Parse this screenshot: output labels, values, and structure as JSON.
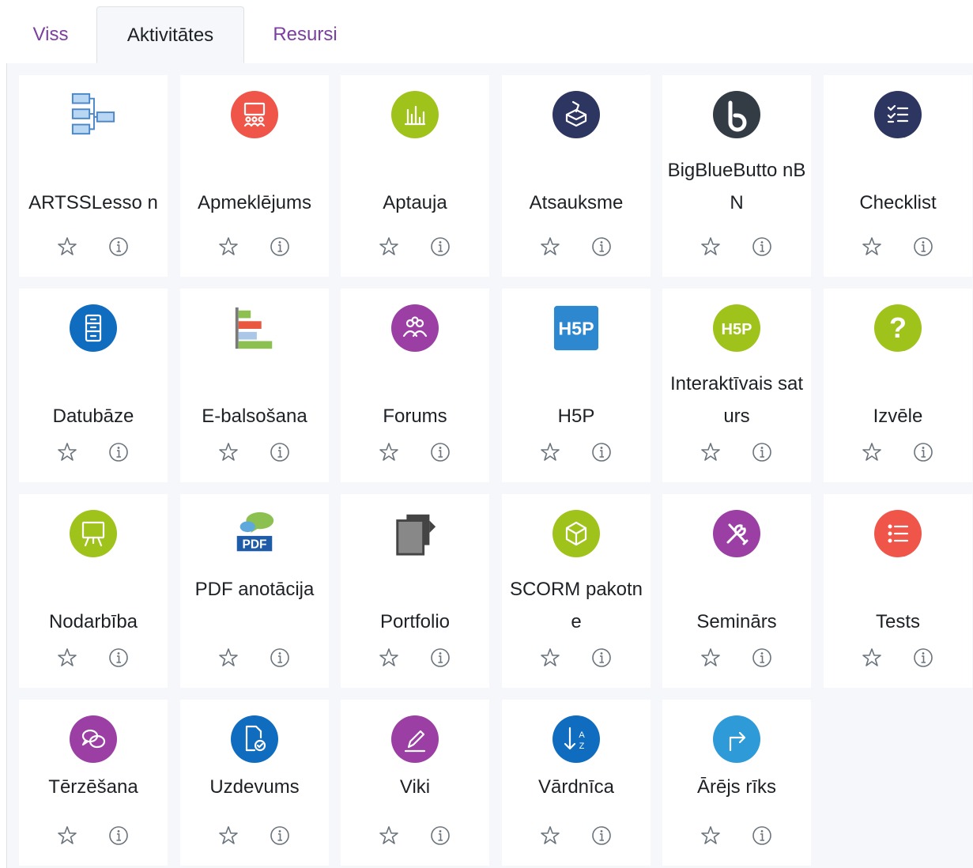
{
  "tabs": [
    {
      "label": "Viss",
      "active": false
    },
    {
      "label": "Aktivitātes",
      "active": true
    },
    {
      "label": "Resursi",
      "active": false
    }
  ],
  "modules": [
    {
      "name": "ARTSSLesso n",
      "icon": "flowchart-icon",
      "color": "#5b9bd5"
    },
    {
      "name": "Apmeklējums",
      "icon": "attendance-icon",
      "color": "#f0554a"
    },
    {
      "name": "Aptauja",
      "icon": "bar-chart-icon",
      "color": "#a0c31c"
    },
    {
      "name": "Atsauksme",
      "icon": "feedback-box-icon",
      "color": "#2d3561"
    },
    {
      "name": "BigBlueButto nBN",
      "icon": "bigbluebutton-icon",
      "color": "#333b45"
    },
    {
      "name": "Checklist",
      "icon": "checklist-icon",
      "color": "#2d3561"
    },
    {
      "name": "Datubāze",
      "icon": "database-icon",
      "color": "#0f6cbf"
    },
    {
      "name": "E-balsošana",
      "icon": "horizontal-bars-icon",
      "color": "#e07a3a"
    },
    {
      "name": "Forums",
      "icon": "people-icon",
      "color": "#9b3fa5"
    },
    {
      "name": "H5P",
      "icon": "h5p-icon",
      "color": "#2e88d0"
    },
    {
      "name": "Interaktīvais saturs",
      "icon": "h5p-round-icon",
      "color": "#a0c31c"
    },
    {
      "name": "Izvēle",
      "icon": "question-icon",
      "color": "#a0c31c"
    },
    {
      "name": "Nodarbība",
      "icon": "presentation-board-icon",
      "color": "#a0c31c"
    },
    {
      "name": "PDF anotācija",
      "icon": "pdf-annotation-icon",
      "color": "#1e5ca8"
    },
    {
      "name": "Portfolio",
      "icon": "portfolio-icon",
      "color": "#555555"
    },
    {
      "name": "SCORM pakotne",
      "icon": "cube-icon",
      "color": "#a0c31c"
    },
    {
      "name": "Seminārs",
      "icon": "tools-icon",
      "color": "#9b3fa5"
    },
    {
      "name": "Tests",
      "icon": "list-icon",
      "color": "#f0554a"
    },
    {
      "name": "Tērzēšana",
      "icon": "chat-bubbles-icon",
      "color": "#9b3fa5"
    },
    {
      "name": "Uzdevums",
      "icon": "document-check-icon",
      "color": "#0f6cbf"
    },
    {
      "name": "Viki",
      "icon": "pencil-icon",
      "color": "#9b3fa5"
    },
    {
      "name": "Vārdnīca",
      "icon": "sort-az-icon",
      "color": "#0f6cbf"
    },
    {
      "name": "Ārējs rīks",
      "icon": "external-arrow-icon",
      "color": "#2e9ad8"
    }
  ],
  "actions": {
    "star_icon": "star-outline-icon",
    "info_icon": "info-circle-icon"
  }
}
